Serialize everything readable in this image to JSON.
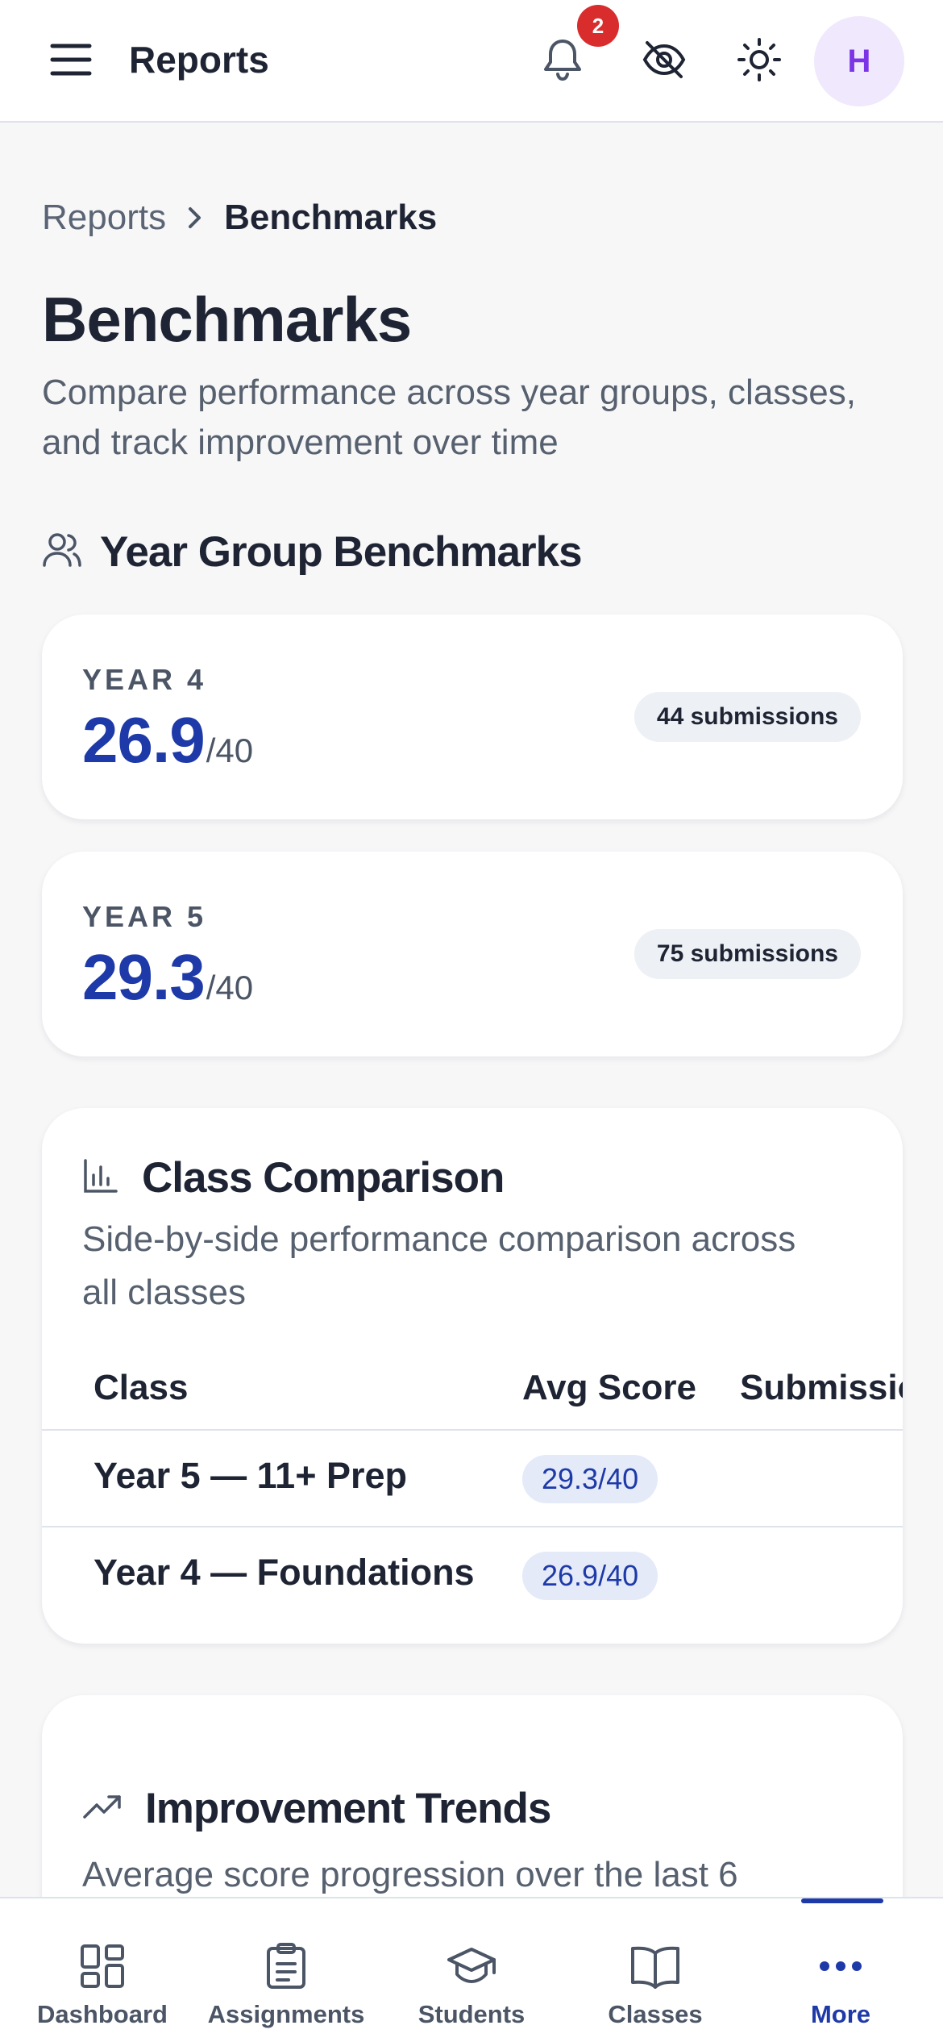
{
  "topbar": {
    "title": "Reports",
    "notification_count": "2",
    "avatar_initial": "H",
    "icons": [
      "menu-icon",
      "bell-icon",
      "eye-off-icon",
      "sun-icon"
    ]
  },
  "breadcrumb": {
    "root": "Reports",
    "current": "Benchmarks"
  },
  "page": {
    "title": "Benchmarks",
    "subtitle": "Compare performance across year groups, classes, and track improvement over time"
  },
  "year_groups": {
    "heading": "Year Group Benchmarks",
    "items": [
      {
        "name": "YEAR 4",
        "score": "26.9",
        "max": "/40",
        "submissions": "44 submissions"
      },
      {
        "name": "YEAR 5",
        "score": "29.3",
        "max": "/40",
        "submissions": "75 submissions"
      }
    ]
  },
  "class_comparison": {
    "heading": "Class Comparison",
    "subtitle": "Side-by-side performance comparison across all classes",
    "columns": [
      "Class",
      "Avg Score",
      "Submissions"
    ],
    "rows": [
      {
        "class": "Year 5 — 11+ Prep",
        "avg": "29.3/40"
      },
      {
        "class": "Year 4 — Foundations",
        "avg": "26.9/40"
      }
    ]
  },
  "improvement_trends": {
    "heading": "Improvement Trends",
    "subtitle": "Average score progression over the last 6"
  },
  "bottom_nav": {
    "items": [
      {
        "label": "Dashboard",
        "icon": "grid-icon"
      },
      {
        "label": "Assignments",
        "icon": "clipboard-icon"
      },
      {
        "label": "Students",
        "icon": "graduation-cap-icon"
      },
      {
        "label": "Classes",
        "icon": "book-icon"
      },
      {
        "label": "More",
        "icon": "more-dots-icon"
      }
    ],
    "active": "More"
  },
  "colors": {
    "accent": "#1e3aa8",
    "badge": "#d92d2d",
    "avatar_bg": "#f0e8fc",
    "avatar_text": "#7c35e6"
  }
}
